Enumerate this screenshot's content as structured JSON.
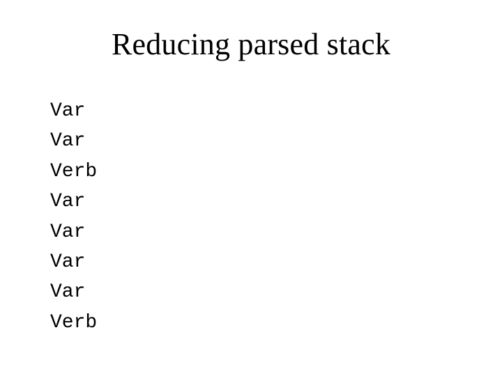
{
  "title": "Reducing parsed stack",
  "stack": {
    "items": [
      "Var",
      "Var",
      "Verb",
      "Var",
      "Var",
      "Var",
      "Var",
      "Verb"
    ]
  }
}
